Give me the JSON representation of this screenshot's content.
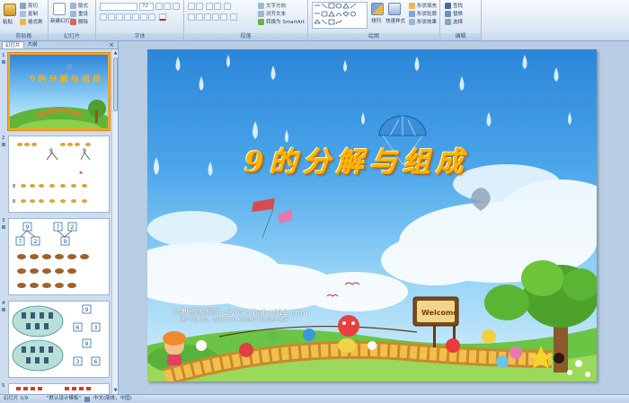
{
  "ribbon": {
    "clipboard": {
      "paste": "粘贴",
      "cut": "剪切",
      "copy": "复制",
      "format_painter": "格式刷",
      "label": "剪贴板"
    },
    "slides": {
      "new_slide": "新建幻灯片",
      "layout": "版式",
      "reset": "重设",
      "delete": "删除",
      "label": "幻灯片"
    },
    "font": {
      "font_name": "",
      "font_size": "72",
      "label": "字体"
    },
    "paragraph": {
      "text_direction": "文字方向",
      "align_text": "对齐文本",
      "smartart": "转换为 SmartArt",
      "label": "段落"
    },
    "drawing": {
      "arrange": "排列",
      "quick_styles": "快速样式",
      "shape_fill": "形状填充",
      "shape_outline": "形状轮廓",
      "shape_effects": "形状效果",
      "label": "绘图"
    },
    "editing": {
      "find": "查找",
      "replace": "替换",
      "select": "选择",
      "label": "编辑"
    }
  },
  "panel": {
    "tabs": [
      "幻灯片",
      "大纲"
    ],
    "close": "×",
    "slide_numbers": [
      "1",
      "2",
      "3",
      "4",
      "5"
    ],
    "thumb2_digits": [
      "9",
      "9",
      "8",
      "8"
    ],
    "thumb3_boxes": [
      "9",
      "7",
      "2",
      "7",
      "2",
      "9"
    ],
    "thumb4_boxes": [
      "9",
      "6",
      "3",
      "9",
      "3",
      "6"
    ]
  },
  "slide": {
    "title": "9的分解与组成",
    "sign": "Welcome",
    "watermark": "幼教资源网站 ziyuan.baby611.com",
    "watermark_sub": "课件下载 儿歌、故事MP3 FLASH课件下载 试卷下载等"
  },
  "status": {
    "slide_pos": "幻灯片 1/9",
    "theme": "\"默认设计模板\"",
    "language": "中文(简体，中国)"
  },
  "colors": {
    "accent": "#f4a52c",
    "ribbon": "#dde8f5",
    "title": "#ffb400"
  }
}
